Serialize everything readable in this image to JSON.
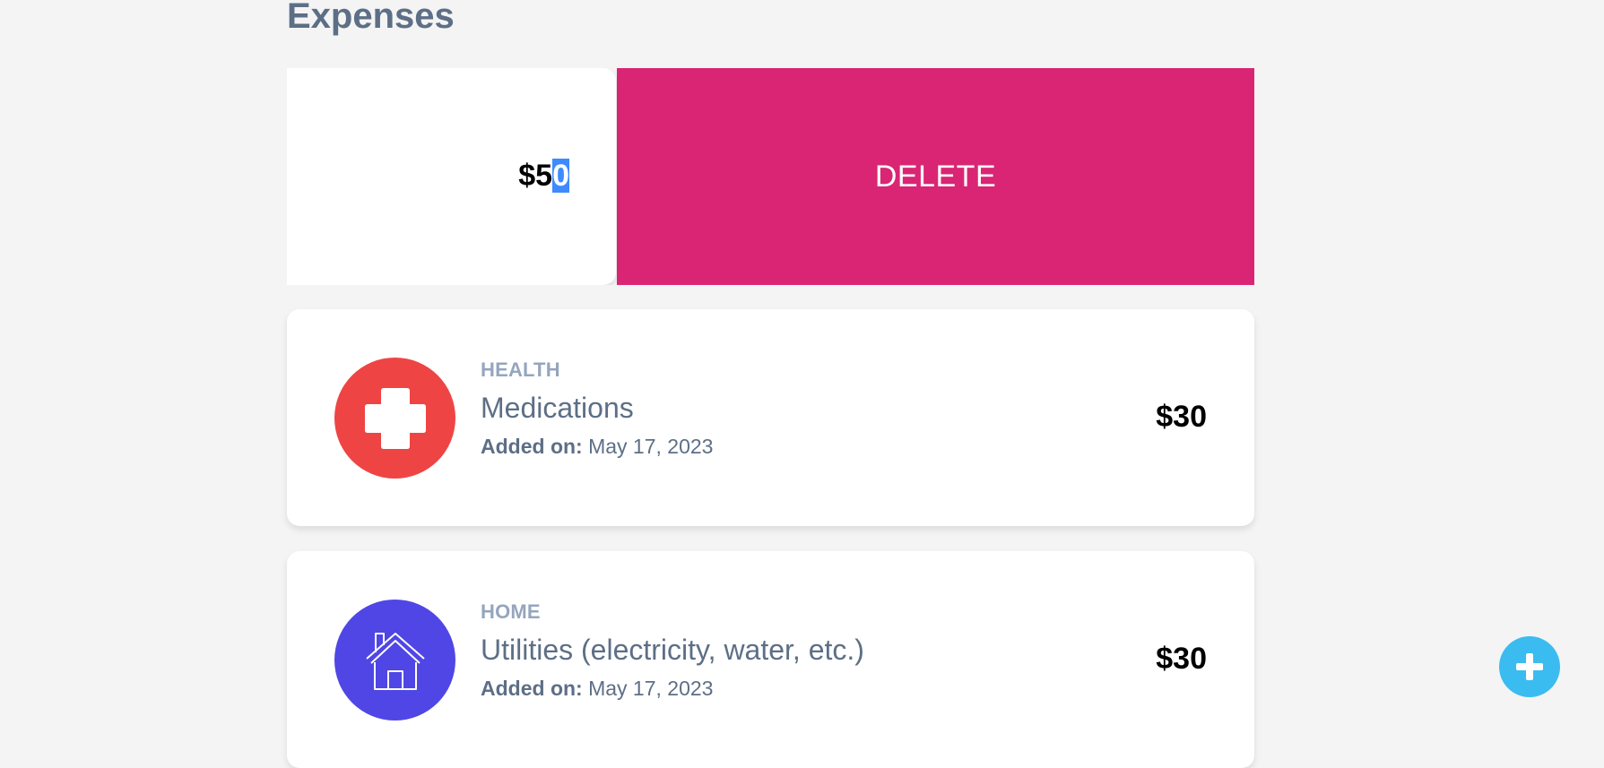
{
  "page": {
    "title": "Expenses"
  },
  "swiped_item": {
    "amount_prefix": "$5",
    "amount_selected": "0",
    "delete_label": "DELETE"
  },
  "expenses": [
    {
      "category": "HEALTH",
      "title": "Medications",
      "added_label": "Added on:",
      "added_date": "May 17, 2023",
      "amount": "$30",
      "icon": "medical-cross-icon",
      "icon_color": "#ef4444"
    },
    {
      "category": "HOME",
      "title": "Utilities (electricity, water, etc.)",
      "added_label": "Added on:",
      "added_date": "May 17, 2023",
      "amount": "$30",
      "icon": "house-icon",
      "icon_color": "#4f46e5"
    }
  ],
  "fab": {
    "icon": "plus-icon",
    "color": "#3bbcf0"
  },
  "colors": {
    "delete": "#d92574",
    "text_primary": "#5d6f86",
    "text_muted": "#95a6bd",
    "selection": "#3d8bff"
  }
}
